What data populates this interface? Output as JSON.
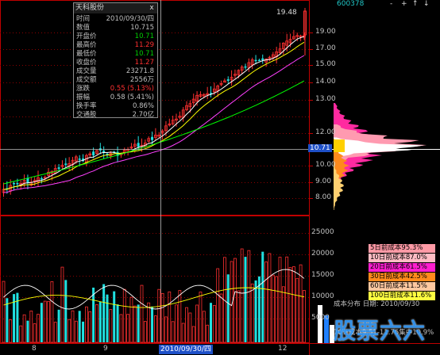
{
  "stock_code": "600378",
  "toolbar_buttons": [
    "-",
    "+",
    "↑",
    "↓"
  ],
  "info_panel": {
    "title": "天科股份",
    "close_label": "x",
    "rows": [
      {
        "k": "时间",
        "v": "2010/09/30/四",
        "color": "#c0c0c0"
      },
      {
        "k": "数值",
        "v": "10.715",
        "color": "#c0c0c0"
      },
      {
        "k": "开盘价",
        "v": "10.71",
        "color": "#00d000"
      },
      {
        "k": "最高价",
        "v": "11.29",
        "color": "#ff3030"
      },
      {
        "k": "最低价",
        "v": "10.71",
        "color": "#00d000"
      },
      {
        "k": "收盘价",
        "v": "11.27",
        "color": "#ff3030"
      },
      {
        "k": "成交量",
        "v": "23271.8",
        "color": "#c0c0c0"
      },
      {
        "k": "成交额",
        "v": "2556万",
        "color": "#c0c0c0"
      },
      {
        "k": "涨跌",
        "v": "0.55 (5.13%)",
        "color": "#ff3030"
      },
      {
        "k": "振幅",
        "v": "0.58 (5.41%)",
        "color": "#c0c0c0"
      },
      {
        "k": "换手率",
        "v": "0.86%",
        "color": "#c0c0c0"
      },
      {
        "k": "交通股",
        "v": "2.70亿",
        "color": "#c0c0c0"
      }
    ]
  },
  "price_axis": [
    "19.00",
    "17.00",
    "15.00",
    "14.00",
    "13.00",
    "12.00",
    "10.00",
    "9.00",
    "8.00"
  ],
  "price_marker": "10.71",
  "high_label": "19.48",
  "volume_axis": [
    "25000",
    "20000",
    "15000",
    "10000",
    "5000"
  ],
  "x_labels": [
    "8",
    "9",
    "12"
  ],
  "date_flag": "2010/09/30/四",
  "cost_legend": [
    {
      "label": "5日前成本95.3%",
      "bg": "#ff9aa6"
    },
    {
      "label": "10日前成本87.0%",
      "bg": "#ffbcc4"
    },
    {
      "label": "20日前成本61.5%",
      "bg": "#ff1ecf"
    },
    {
      "label": "30日前成本42.5%",
      "bg": "#ff8a1c"
    },
    {
      "label": "60日前成本11.5%",
      "bg": "#ffc8a0"
    },
    {
      "label": "100日前成本11.6%",
      "bg": "#ffff40"
    }
  ],
  "cost_info": {
    "line1": "成本分布 日期: 2010/09/30",
    "line2": "70%成本9.51-11.76集中10.9%"
  },
  "watermark": "股票六六",
  "colors": {
    "up": "#ff3030",
    "down": "#20e0e0",
    "ma5": "#ffffff",
    "ma10": "#ffff00",
    "ma20": "#ff40ff",
    "ma60": "#00ff00",
    "grid": "#8b0000",
    "axis": "#c00000"
  }
}
